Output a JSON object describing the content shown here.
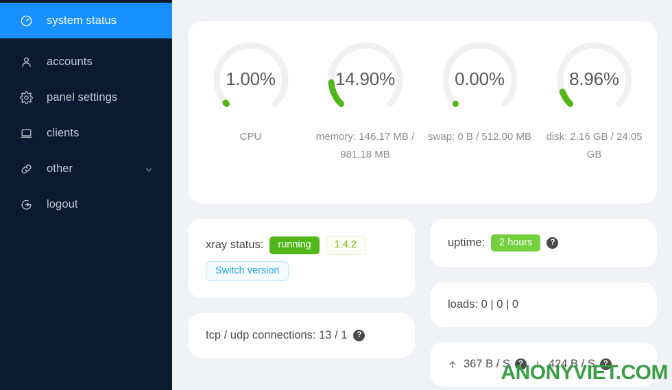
{
  "sidebar": {
    "items": [
      {
        "id": "system-status",
        "label": "system status",
        "icon": "dashboard-icon",
        "active": true,
        "caret": false
      },
      {
        "id": "accounts",
        "label": "accounts",
        "icon": "user-icon",
        "active": false,
        "caret": false
      },
      {
        "id": "panel-settings",
        "label": "panel settings",
        "icon": "gear-icon",
        "active": false,
        "caret": false
      },
      {
        "id": "clients",
        "label": "clients",
        "icon": "laptop-icon",
        "active": false,
        "caret": false
      },
      {
        "id": "other",
        "label": "other",
        "icon": "link-icon",
        "active": false,
        "caret": true
      },
      {
        "id": "logout",
        "label": "logout",
        "icon": "logout-icon",
        "active": false,
        "caret": false
      }
    ],
    "active_color": "#1890ff",
    "background_color": "#0b1a2e"
  },
  "gauges": [
    {
      "percent": "1.00%",
      "value": 1.0,
      "label": "CPU",
      "color": "#52b61b"
    },
    {
      "percent": "14.90%",
      "value": 14.9,
      "label": "memory: 146.17 MB / 981.18 MB",
      "color": "#52b61b"
    },
    {
      "percent": "0.00%",
      "value": 0.0,
      "label": "swap: 0 B / 512.00 MB",
      "color": "#52b61b"
    },
    {
      "percent": "8.96%",
      "value": 8.96,
      "label": "disk: 2.16 GB / 24.05 GB",
      "color": "#52b61b"
    }
  ],
  "xray": {
    "label": "xray status:",
    "status": "running",
    "version": "1.4.2",
    "switch_version_label": "Switch version"
  },
  "uptime": {
    "label": "uptime:",
    "value": "2 hours",
    "help": "?"
  },
  "loads": {
    "text": "loads: 0 | 0 | 0"
  },
  "connections": {
    "text": "tcp / udp connections: 13 / 1",
    "help": "?"
  },
  "network": {
    "up_value": "367 B / S",
    "down_value": "424 B / S",
    "up_help": "?",
    "down_help": "?"
  },
  "watermark": {
    "text": "ANONYVIET.COM",
    "color": "#3a9e45"
  }
}
